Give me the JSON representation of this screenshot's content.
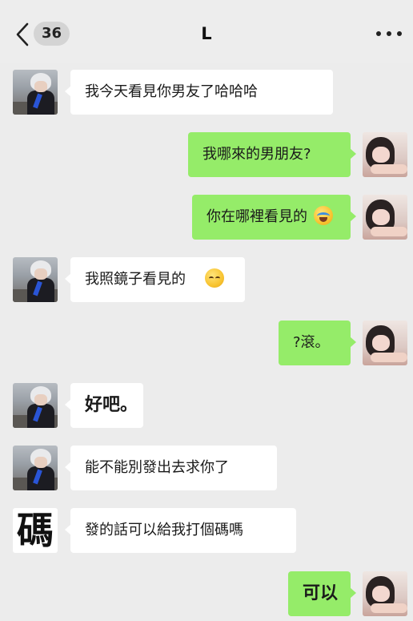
{
  "header": {
    "back_icon": "chevron-left-icon",
    "unread_count": "36",
    "title": "L",
    "more_icon": "more-horizontal-icon"
  },
  "colors": {
    "incoming_bubble": "#ffffff",
    "outgoing_bubble": "#95ec69",
    "background": "#ececec"
  },
  "avatars": {
    "contact_character": "碼"
  },
  "messages": [
    {
      "side": "in",
      "text": "我今天看見你男友了哈哈哈"
    },
    {
      "side": "out",
      "text": "我哪來的男朋友?"
    },
    {
      "side": "out",
      "text": "你在哪裡看見的",
      "emoji": "crying-laughing-emoji"
    },
    {
      "side": "in",
      "text": "我照鏡子看見的",
      "emoji": "sleepy-face-emoji"
    },
    {
      "side": "out",
      "text": "?滾。"
    },
    {
      "side": "in",
      "text": "好吧。"
    },
    {
      "side": "in",
      "text": "能不能別發出去求你了"
    },
    {
      "side": "in",
      "text": "發的話可以給我打個碼嗎"
    },
    {
      "side": "out",
      "text": "可以"
    }
  ]
}
